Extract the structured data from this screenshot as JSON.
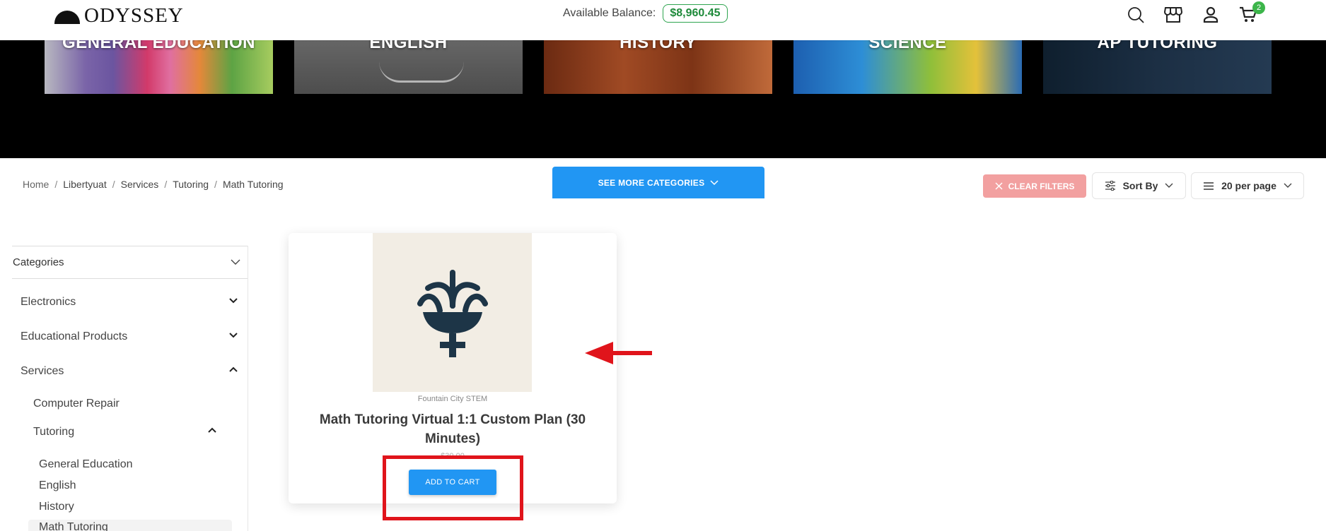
{
  "header": {
    "logo_text": "ODYSSEY",
    "balance_label": "Available Balance:",
    "balance_amount": "$8,960.45",
    "cart_count": "2",
    "icons": [
      "search-icon",
      "store-icon",
      "user-icon",
      "cart-icon"
    ]
  },
  "banner": {
    "categories": [
      "GENERAL EDUCATION",
      "ENGLISH",
      "HISTORY",
      "SCIENCE",
      "AP TUTORING"
    ],
    "see_more_label": "SEE MORE CATEGORIES"
  },
  "breadcrumb": [
    "Home",
    "Libertyuat",
    "Services",
    "Tutoring",
    "Math Tutoring"
  ],
  "toolbar": {
    "clear_filters": "CLEAR FILTERS",
    "sort_by": "Sort By",
    "per_page": "20 per page"
  },
  "sidebar": {
    "header": "Categories",
    "items": {
      "electronics": "Electronics",
      "educational_products": "Educational Products",
      "services": "Services",
      "computer_repair": "Computer Repair",
      "tutoring": "Tutoring",
      "general_education": "General Education",
      "english": "English",
      "history": "History",
      "math_tutoring": "Math Tutoring"
    }
  },
  "product": {
    "vendor": "Fountain City STEM",
    "title": "Math Tutoring Virtual 1:1 Custom Plan (30 Minutes)",
    "price": "$30.00",
    "add_to_cart": "ADD TO CART"
  },
  "colors": {
    "accent": "#2196f3",
    "balance_green": "#1e8a3a",
    "clear_filters": "#f2a0a0",
    "annotation_red": "#e0141b",
    "product_icon": "#1d3547"
  }
}
